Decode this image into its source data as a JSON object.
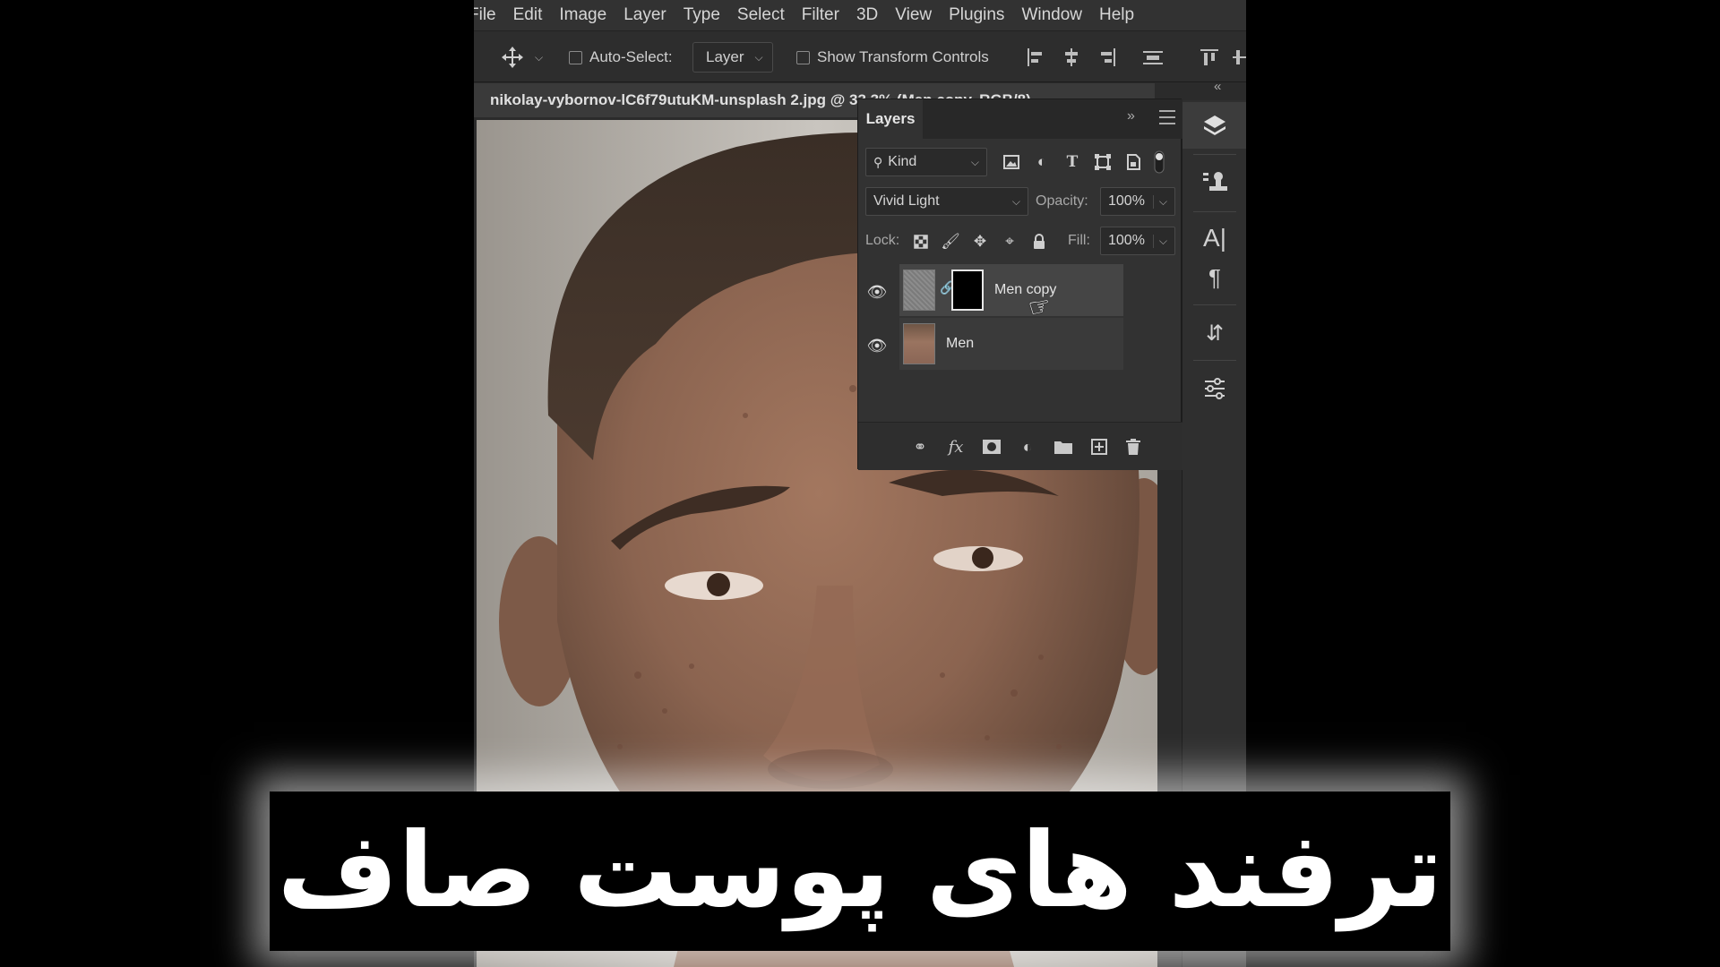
{
  "menu": [
    "File",
    "Edit",
    "Image",
    "Layer",
    "Type",
    "Select",
    "Filter",
    "3D",
    "View",
    "Plugins",
    "Window",
    "Help"
  ],
  "options_bar": {
    "auto_select_label": "Auto-Select:",
    "auto_select_target": "Layer",
    "show_transform_label": "Show Transform Controls"
  },
  "document": {
    "tab_title": "nikolay-vybornov-lC6f79utuKM-unsplash 2.jpg @ 33.3% (Men copy, RGB/8)"
  },
  "layers_panel": {
    "title": "Layers",
    "filter_kind": "Kind",
    "blend_mode": "Vivid Light",
    "opacity_label": "Opacity:",
    "opacity_value": "100%",
    "lock_label": "Lock:",
    "fill_label": "Fill:",
    "fill_value": "100%",
    "layers": [
      {
        "name": "Men copy",
        "visible": true,
        "selected": true,
        "has_mask": true
      },
      {
        "name": "Men",
        "visible": true,
        "selected": false,
        "has_mask": false
      }
    ]
  },
  "icons": {
    "move_tool": "move-icon",
    "layers": "layers-icon",
    "stamp": "clone-stamp-icon",
    "character": "character-icon",
    "paragraph": "paragraph-icon",
    "swap": "swap-icon",
    "adjust": "sliders-icon"
  },
  "colors": {
    "app_bg": "#2b2b2b",
    "panel_bg": "#323232",
    "banner_bg": "#000000",
    "banner_text": "#ffffff"
  },
  "banner": {
    "text": "ترفند های پوست صاف"
  }
}
